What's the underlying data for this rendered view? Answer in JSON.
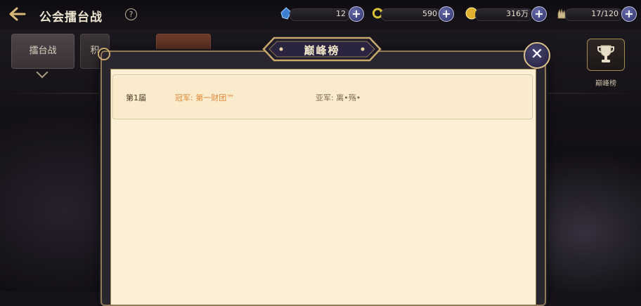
{
  "header": {
    "back_icon": "back-arrow-icon",
    "title": "公会擂台战",
    "help_icon": "question-circle-icon"
  },
  "resources": [
    {
      "icon": "crystal-icon",
      "value": "12"
    },
    {
      "icon": "refresh-swirl-icon",
      "value": "590"
    },
    {
      "icon": "gold-coin-icon",
      "value": "316万"
    },
    {
      "icon": "stamina-hand-icon",
      "value": "17/120"
    }
  ],
  "tabs": [
    {
      "label": "擂台战"
    },
    {
      "label": "积"
    },
    {
      "label": ""
    }
  ],
  "side": {
    "peak_button_icon": "trophy-icon",
    "peak_button_label": "巅峰榜"
  },
  "modal": {
    "title": "巅峰榜",
    "close_icon": "close-x-icon",
    "rows": [
      {
        "season": "第1届",
        "champion": "冠军: 第一财团™",
        "runner_up": "亚军: 离•殇•"
      }
    ]
  },
  "colors": {
    "accent_gold": "#c9a96b",
    "champion_orange": "#e1883b",
    "panel_cream": "#fbefd6",
    "plus_button": "#2c2f63"
  }
}
